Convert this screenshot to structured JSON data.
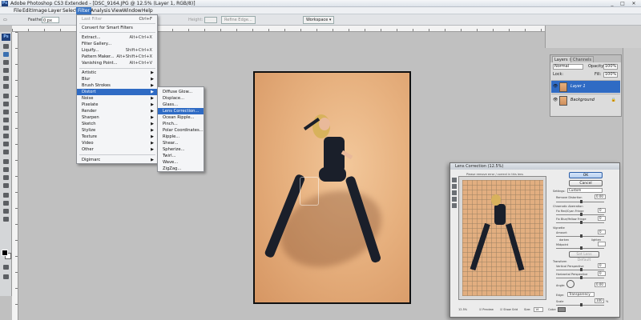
{
  "window": {
    "title": "Adobe Photoshop CS3 Extended - [DSC_9164.JPG @ 12.5% (Layer 1, RGB/8)]",
    "app_icon": "Ps",
    "minimize": "_",
    "maximize": "□",
    "close": "✕"
  },
  "menubar": {
    "items": [
      "File",
      "Edit",
      "Image",
      "Layer",
      "Select",
      "Filter",
      "Analysis",
      "View",
      "Window",
      "Help"
    ],
    "active": "Filter"
  },
  "options": {
    "feather_label": "Feather:",
    "feather_value": "0 px",
    "height_label": "Height:",
    "refine_edge": "Refine Edge...",
    "workspace": "Workspace ▾"
  },
  "toolbox": {
    "logo": "Ps"
  },
  "filter_menu": {
    "last_filter": "Last Filter",
    "last_filter_sc": "Ctrl+F",
    "convert_smart": "Convert for Smart Filters",
    "extract": "Extract...",
    "extract_sc": "Alt+Ctrl+X",
    "filter_gallery": "Filter Gallery...",
    "liquify": "Liquify...",
    "liquify_sc": "Shift+Ctrl+X",
    "pattern_maker": "Pattern Maker...",
    "pattern_maker_sc": "Alt+Shift+Ctrl+X",
    "vanishing_point": "Vanishing Point...",
    "vanishing_point_sc": "Alt+Ctrl+V",
    "submenus": [
      "Artistic",
      "Blur",
      "Brush Strokes",
      "Distort",
      "Noise",
      "Pixelate",
      "Render",
      "Sharpen",
      "Sketch",
      "Stylize",
      "Texture",
      "Video",
      "Other"
    ],
    "highlighted": "Distort",
    "digimarc": "Digimarc"
  },
  "distort_menu": {
    "items": [
      "Diffuse Glow...",
      "Displace...",
      "Glass...",
      "Lens Correction...",
      "Ocean Ripple...",
      "Pinch...",
      "Polar Coordinates...",
      "Ripple...",
      "Shear...",
      "Spherize...",
      "Twirl...",
      "Wave...",
      "ZigZag..."
    ],
    "highlighted": "Lens Correction..."
  },
  "layers_panel": {
    "tab_layers": "Layers ×",
    "tab_channels": "Channels",
    "blend_mode": "Normal",
    "opacity_label": "Opacity:",
    "opacity_value": "100%",
    "lock_label": "Lock:",
    "fill_label": "Fill:",
    "fill_value": "100%",
    "layers": [
      {
        "name": "Layer 1",
        "active": true
      },
      {
        "name": "Background",
        "active": false,
        "lock": "🔒"
      }
    ],
    "eye": "👁"
  },
  "lens_dialog": {
    "title": "Lens Correction (12.5%)",
    "subtitle": "Please remove error / correct in this lens",
    "ok": "OK",
    "cancel": "Cancel",
    "settings_label": "Settings:",
    "settings_value": "Custom",
    "remove_distortion": "Remove Distortion",
    "remove_distortion_value": "0.00",
    "chromatic_header": "Chromatic Aberration",
    "fix_rc": "Fix Red/Cyan Fringe",
    "fix_by": "Fix Blue/Yellow Fringe",
    "vignette_header": "Vignette",
    "amount": "Amount",
    "darken": "darken",
    "lighten": "lighten",
    "midpoint": "Midpoint",
    "set_lens_default": "Set Lens Default",
    "transform_header": "Transform",
    "vertical_perspective": "Vertical Perspective",
    "horizontal_perspective": "Horizontal Perspective",
    "angle": "Angle:",
    "angle_value": "0.00",
    "edge_label": "Edge:",
    "edge_value": "Transparency",
    "scale_label": "Scale",
    "scale_value": "100",
    "scale_unit": "%",
    "zoom": "12.5%",
    "preview": "Preview",
    "show_grid": "Show Grid",
    "size_label": "Size:",
    "size_value": "16",
    "color_label": "Color:",
    "zero": "0"
  }
}
